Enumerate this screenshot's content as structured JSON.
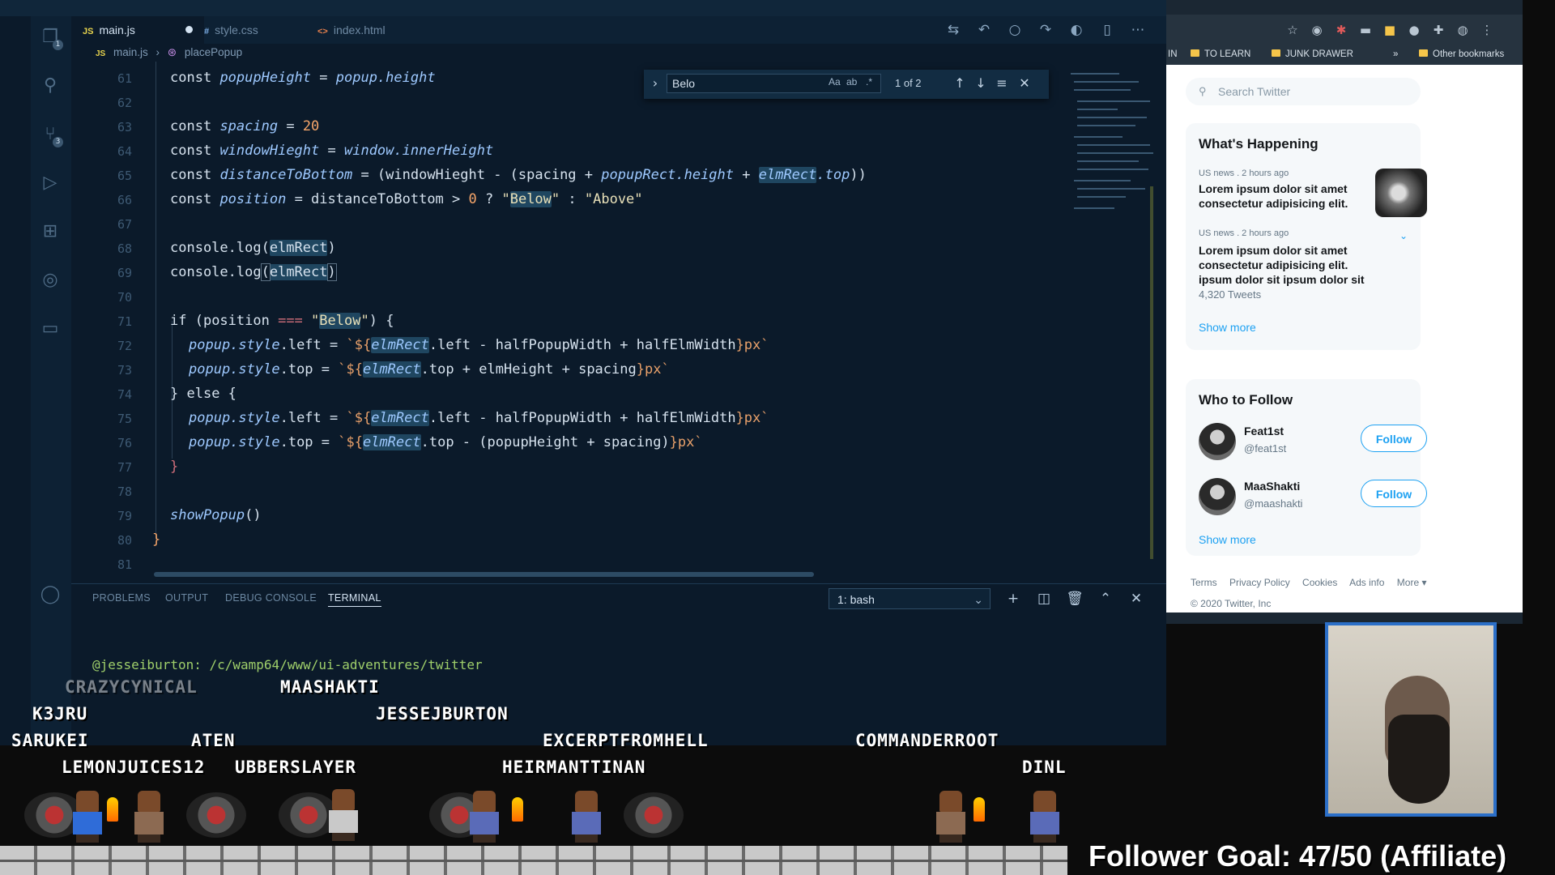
{
  "vscode": {
    "tabs": [
      {
        "icon": "JS",
        "label": "main.js",
        "modified": true
      },
      {
        "icon": "#",
        "label": "style.css"
      },
      {
        "icon": "<>",
        "label": "index.html"
      }
    ],
    "breadcrumb": [
      "main.js",
      "placePopup"
    ],
    "line_numbers": [
      "61",
      "62",
      "63",
      "64",
      "65",
      "66",
      "67",
      "68",
      "69",
      "70",
      "71",
      "72",
      "73",
      "74",
      "75",
      "76",
      "77",
      "78",
      "79",
      "80",
      "81"
    ],
    "find": {
      "value": "Belo",
      "count": "1 of 2",
      "opt_case": "Aa",
      "opt_word": "ab",
      "opt_regex": ".*"
    },
    "panel_tabs": [
      "PROBLEMS",
      "OUTPUT",
      "DEBUG CONSOLE",
      "TERMINAL"
    ],
    "terminal_select": "1: bash",
    "prompt": "@jesseiburton: /c/wamp64/www/ui-adventures/twitter"
  },
  "chrome": {
    "bookmarks": [
      "IN",
      "TO LEARN",
      "JUNK DRAWER",
      "»",
      "Other bookmarks"
    ]
  },
  "twitter": {
    "search_placeholder": "Search Twitter",
    "whats_happening": {
      "title": "What's Happening",
      "trends": [
        {
          "meta": "US news . 2 hours ago",
          "text": "Lorem ipsum dolor sit amet consectetur adipisicing elit."
        },
        {
          "meta": "US news . 2 hours ago",
          "text": "Lorem ipsum dolor sit amet consectetur adipisicing elit. ipsum dolor sit ipsum dolor sit",
          "count": "4,320 Tweets"
        }
      ],
      "show_more": "Show more"
    },
    "who_to_follow": {
      "title": "Who to Follow",
      "users": [
        {
          "name": "Feat1st",
          "handle": "@feat1st",
          "button": "Follow"
        },
        {
          "name": "MaaShakti",
          "handle": "@maashakti",
          "button": "Follow"
        }
      ],
      "show_more": "Show more"
    },
    "footer_links": [
      "Terms",
      "Privacy Policy",
      "Cookies",
      "Ads info",
      "More ▾"
    ],
    "copyright": "© 2020 Twitter, Inc"
  },
  "overlay": {
    "usernames": [
      "CRAZYCYNICAL",
      "MAASHAKTI",
      "K3JRU",
      "JESSEJBURTON",
      "SARUKEI",
      "ATEN",
      "EXCERPTFROMHELL",
      "COMMANDERROOT",
      "LEMONJUICES12",
      "UBBERSLAYER",
      "HEIRMANTTINAN",
      "DINL"
    ],
    "follower_goal": "Follower Goal: 47/50 (Affiliate)"
  },
  "colors": {
    "editor_bg": "#0b1a2a",
    "twitter_blue": "#1da1f2",
    "webcam_border": "#2b6fc8"
  },
  "icons": [
    "explorer-icon",
    "search-icon",
    "source-control-icon",
    "run-icon",
    "extensions-icon",
    "remote-icon",
    "folder-icon",
    "account-icon"
  ]
}
